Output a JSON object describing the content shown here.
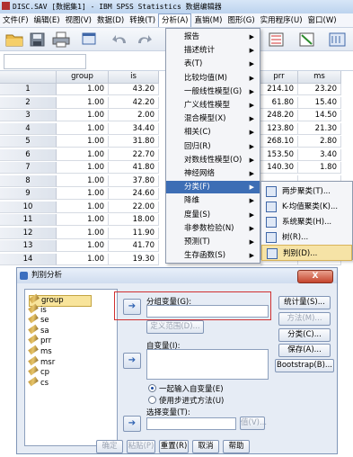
{
  "window": {
    "title": "DISC.SAV [数据集1] - IBM SPSS Statistics 数据编辑器"
  },
  "menubar": {
    "items": [
      "文件(F)",
      "编辑(E)",
      "视图(V)",
      "数据(D)",
      "转换(T)",
      "分析(A)",
      "直销(M)",
      "图形(G)",
      "实用程序(U)",
      "窗口(W)"
    ],
    "active": "分析(A)"
  },
  "toolbar": {
    "icons": [
      "open-folder-icon",
      "save-icon",
      "print-icon",
      "dialog-recall-icon",
      "undo-icon",
      "redo-icon"
    ]
  },
  "grid": {
    "columns": [
      "group",
      "is",
      "prr",
      "ms"
    ],
    "rows": [
      {
        "n": "1",
        "group": "1.00",
        "is": "43.20",
        "prr": "214.10",
        "ms": "23.20"
      },
      {
        "n": "2",
        "group": "1.00",
        "is": "42.20",
        "prr": "61.80",
        "ms": "15.40"
      },
      {
        "n": "3",
        "group": "1.00",
        "is": "2.00",
        "prr": "248.20",
        "ms": "14.50"
      },
      {
        "n": "4",
        "group": "1.00",
        "is": "34.40",
        "prr": "123.80",
        "ms": "21.30"
      },
      {
        "n": "5",
        "group": "1.00",
        "is": "31.80",
        "prr": "268.10",
        "ms": "2.80"
      },
      {
        "n": "6",
        "group": "1.00",
        "is": "22.70",
        "prr": "153.50",
        "ms": "3.40"
      },
      {
        "n": "7",
        "group": "1.00",
        "is": "41.80",
        "prr": "140.30",
        "ms": "1.80"
      },
      {
        "n": "8",
        "group": "1.00",
        "is": "37.80",
        "prr": "",
        "ms": ""
      },
      {
        "n": "9",
        "group": "1.00",
        "is": "24.60",
        "prr": "",
        "ms": ""
      },
      {
        "n": "10",
        "group": "1.00",
        "is": "22.00",
        "prr": "",
        "ms": ""
      },
      {
        "n": "11",
        "group": "1.00",
        "is": "18.00",
        "prr": "",
        "ms": ""
      },
      {
        "n": "12",
        "group": "1.00",
        "is": "11.90",
        "prr": "",
        "ms": ""
      },
      {
        "n": "13",
        "group": "1.00",
        "is": "41.70",
        "prr": "",
        "ms": ""
      },
      {
        "n": "14",
        "group": "1.00",
        "is": "19.30",
        "prr": "",
        "ms": ""
      }
    ]
  },
  "analyze_menu": {
    "items": [
      {
        "label": "报告",
        "arrow": true
      },
      {
        "label": "描述统计",
        "arrow": true
      },
      {
        "label": "表(T)",
        "arrow": true
      },
      {
        "label": "比较均值(M)",
        "arrow": true
      },
      {
        "label": "一般线性模型(G)",
        "arrow": true
      },
      {
        "label": "广义线性模型",
        "arrow": true
      },
      {
        "label": "混合模型(X)",
        "arrow": true
      },
      {
        "label": "相关(C)",
        "arrow": true
      },
      {
        "label": "回归(R)",
        "arrow": true
      },
      {
        "label": "对数线性模型(O)",
        "arrow": true
      },
      {
        "label": "神经网络",
        "arrow": true
      },
      {
        "label": "分类(F)",
        "arrow": true
      },
      {
        "label": "降维",
        "arrow": true
      },
      {
        "label": "度量(S)",
        "arrow": true
      },
      {
        "label": "非参数检验(N)",
        "arrow": true
      },
      {
        "label": "预测(T)",
        "arrow": true
      },
      {
        "label": "生存函数(S)",
        "arrow": true
      }
    ],
    "highlighted": "分类(F)"
  },
  "classify_submenu": {
    "items": [
      "两步聚类(T)...",
      "K-均值聚类(K)...",
      "系统聚类(H)...",
      "树(R)...",
      "判别(D)..."
    ],
    "highlighted": "判别(D)..."
  },
  "dialog": {
    "title": "判别分析",
    "close": "X",
    "variables": [
      "group",
      "is",
      "se",
      "sa",
      "prr",
      "ms",
      "msr",
      "cp",
      "cs"
    ],
    "selected_variable": "group",
    "grouping_label": "分组变量(G):",
    "grouping_value": "",
    "define_range": "定义范围(D)...",
    "independents_label": "自变量(I):",
    "radio_enter": "一起输入自变量(E)",
    "radio_stepwise": "使用步进式方法(U)",
    "selection_label": "选择变量(T):",
    "value_button": "值(V)...",
    "side_buttons": {
      "statistics": "统计量(S)...",
      "method": "方法(M)...",
      "classify": "分类(C)...",
      "save": "保存(A)...",
      "bootstrap": "Bootstrap(B)..."
    },
    "bottom_buttons": {
      "ok": "确定",
      "paste": "粘贴(P)",
      "reset": "重置(R)",
      "cancel": "取消",
      "help": "帮助"
    }
  }
}
